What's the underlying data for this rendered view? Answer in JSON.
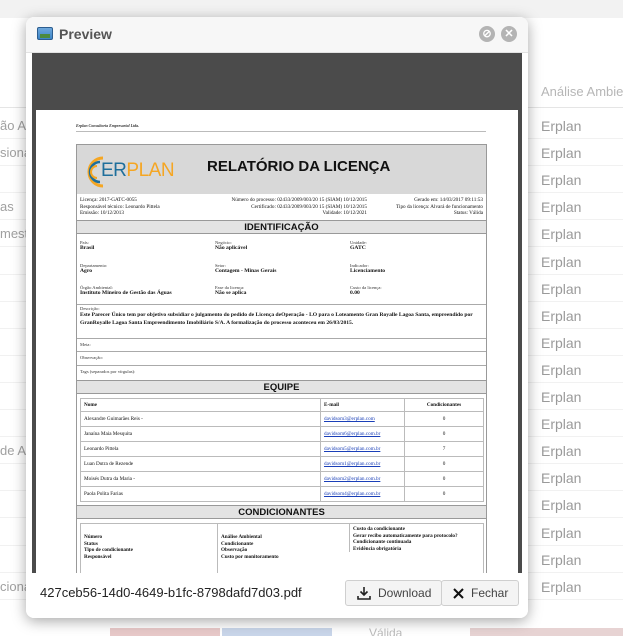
{
  "background": {
    "column_header": "Análise Ambiental",
    "rows": [
      {
        "left": "ão Am",
        "right": "Erplan"
      },
      {
        "left": "sional",
        "right": "Erplan"
      },
      {
        "left": "",
        "right": "Erplan"
      },
      {
        "left": "as",
        "right": "Erplan"
      },
      {
        "left": "mest",
        "right": "Erplan"
      },
      {
        "left": "",
        "right": "Erplan"
      },
      {
        "left": "",
        "right": "Erplan"
      },
      {
        "left": "",
        "right": "Erplan"
      },
      {
        "left": "",
        "right": "Erplan"
      },
      {
        "left": "",
        "right": "Erplan"
      },
      {
        "left": "",
        "right": "Erplan"
      },
      {
        "left": "",
        "right": "Erplan"
      },
      {
        "left": "de A",
        "right": "Erplan"
      },
      {
        "left": "",
        "right": "Erplan"
      },
      {
        "left": "",
        "right": "Erplan"
      },
      {
        "left": "",
        "right": "Erplan"
      },
      {
        "left": "",
        "right": "Erplan"
      },
      {
        "left": "cional",
        "right": "Erplan"
      }
    ],
    "bottom_cell": "Válida"
  },
  "modal": {
    "title": "Preview",
    "filename": "427ceb56-14d0-4649-b1fc-8798dafd7d03.pdf",
    "download_label": "Download",
    "close_label": "Fechar"
  },
  "document": {
    "header_text": "Erplan Consultoria Empresarial Ltda.",
    "logo_e": "ER",
    "logo_p": "PLAN",
    "report_title": "RELATÓRIO DA LICENÇA",
    "meta": {
      "licenca": "Licença: 2017-GATC-0055",
      "responsavel": "Responsável técnico: Leonardo Pittela",
      "emissao": "Emissão: 10/12/2013",
      "processo": "Número do processo: 02433/2009/003/20 15 (SIAM) 10/12/2015",
      "certificado": "Certificado: 02433/2009/003/20 15 (SIAM) 10/12/2015",
      "validade": "Validade: 10/12/2021",
      "gerado": "Gerado em: 14/03/2017 09:11:53",
      "tipo": "Tipo da licença: Alvará de funcionamento",
      "status": "Status: Válida"
    },
    "identificacao_title": "IDENTIFICAÇÃO",
    "ident": {
      "pais_lbl": "País:",
      "pais": "Brasil",
      "negocio_lbl": "Negócio:",
      "negocio": "Não aplicável",
      "unidade_lbl": "Unidade:",
      "unidade": "GATC",
      "dep_lbl": "Departamento:",
      "dep": "Agro",
      "setor_lbl": "Setor:",
      "setor": "Contagem - Minas Gerais",
      "indicador_lbl": "Indicador:",
      "indicador": "Licenciamento",
      "orgao_lbl": "Órgão Ambiental:",
      "orgao": "Instituto Mineiro de Gestão das Águas",
      "fase_lbl": "Fase da licença:",
      "fase": "Não se aplica",
      "custo_lbl": "Custo da licença:",
      "custo": "0.00",
      "descricao_lbl": "Descrição:",
      "descricao": "Este Parecer Único tem por objetivo subsidiar o julgamento do pedido de Licença deOperação - LO para o Loteamento Gran Royalle Lagoa Santa, empreendido por GranRoyalle Lagoa Santa Empreendimento Imobiliário S/A. A formalização do processo aconteceu em 26/03/2015.",
      "meta_lbl": "Meta:",
      "obs_lbl": "Observação:",
      "tags_lbl": "Tags (separados por vírgulas):"
    },
    "equipe_title": "EQUIPE",
    "equipe_headers": {
      "nome": "Nome",
      "email": "E-mail",
      "cond": "Condicionantes"
    },
    "equipe": [
      {
        "nome": "Alexandre Guimarães Reis -",
        "email": "davidsom3@erplan.com",
        "cond": "0"
      },
      {
        "nome": "Janaína Maia Mesquita",
        "email": "davidsom6@erplan.com.br",
        "cond": "0"
      },
      {
        "nome": "Leonardo Pittela",
        "email": "davidsom5@erplan.com.br",
        "cond": "7"
      },
      {
        "nome": "Luan Dutra de Rezende",
        "email": "davidsom1@erplan.com.br",
        "cond": "0"
      },
      {
        "nome": "Moisés Dutra da Maria -",
        "email": "davidsom2@erplan.com.br",
        "cond": "0"
      },
      {
        "nome": "Paola Polita Farias",
        "email": "davidsom4@erplan.com.br",
        "cond": "0"
      }
    ],
    "condicionantes_title": "CONDICIONANTES",
    "cond_col1": [
      "Número",
      "Status",
      "Tipo de condicionante",
      "Responsável"
    ],
    "cond_col2": [
      "Análise Ambiental",
      "Condicionante",
      "Observação",
      "Custo por monitoramento"
    ],
    "cond_col3": [
      "Custo da condicionante",
      "Gerar recibo automaticamente para protocolo?",
      "Condicionante continuada",
      "Evidência obrigatória"
    ]
  },
  "colors": {
    "accent_blue": "#1f6f9c",
    "accent_orange": "#f5a623",
    "link": "#1a3fb8"
  }
}
